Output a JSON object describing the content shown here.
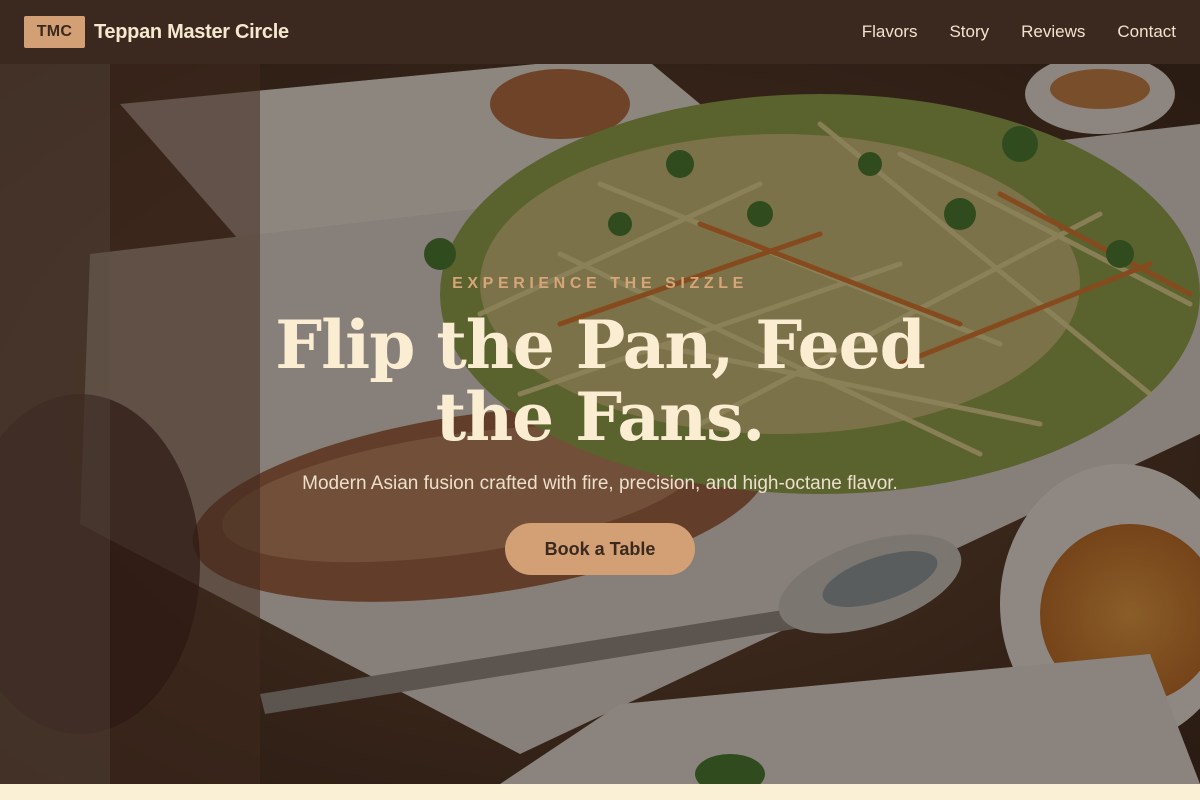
{
  "nav": {
    "logo": "TMC",
    "brand": "Teppan Master Circle",
    "links": [
      "Flavors",
      "Story",
      "Reviews",
      "Contact"
    ]
  },
  "hero": {
    "eyebrow": "EXPERIENCE THE SIZZLE",
    "headline": "Flip the Pan, Feed the Fans.",
    "subhead": "Modern Asian fusion crafted with fire, precision, and high-octane flavor.",
    "cta": "Book a Table"
  },
  "colors": {
    "nav_bg": "#3b2920",
    "accent": "#d2a074",
    "headline": "#fbedd2",
    "page_bg": "#faf0d6"
  }
}
